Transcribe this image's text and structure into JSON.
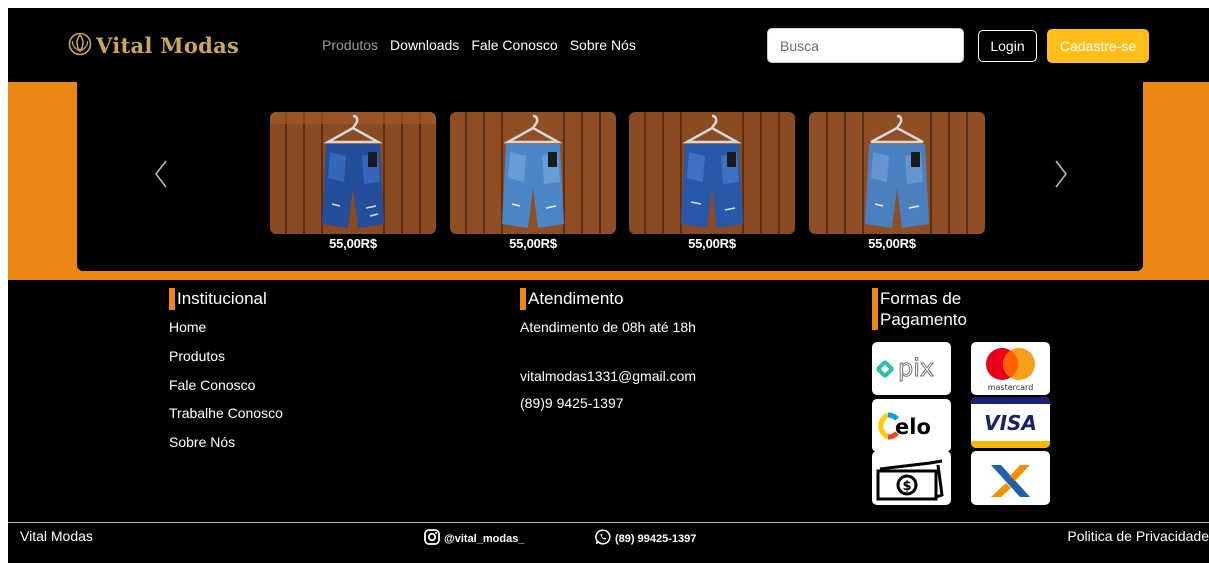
{
  "header": {
    "brand": "Vital Modas",
    "nav": [
      "Produtos",
      "Downloads",
      "Fale Conosco",
      "Sobre Nós"
    ],
    "active_nav": "Produtos",
    "search_placeholder": "Busca",
    "login_label": "Login",
    "signup_label": "Cadastre-se"
  },
  "carousel": {
    "products": [
      {
        "image": "jeans-shorts-dark",
        "price": "55,00R$"
      },
      {
        "image": "jeans-shorts-light",
        "price": "55,00R$"
      },
      {
        "image": "jeans-shorts-dark",
        "price": "55,00R$"
      },
      {
        "image": "jeans-shorts-light",
        "price": "55,00R$"
      }
    ],
    "prev_icon": "chevron-left-icon",
    "next_icon": "chevron-right-icon"
  },
  "institucional": {
    "title": "Institucional",
    "links": [
      "Home",
      "Produtos",
      "Fale Conosco",
      "Trabalhe Conosco",
      "Sobre Nós"
    ]
  },
  "atendimento": {
    "title": "Atendimento",
    "hours": "Atendimento de 08h até 18h",
    "email": "vitalmodas1331@gmail.com",
    "phone": "(89)9 9425-1397"
  },
  "pagamento": {
    "title_line1": "Formas de",
    "title_line2": "Pagamento",
    "methods": [
      "pix",
      "mastercard",
      "elo",
      "visa",
      "cash",
      "caixa"
    ],
    "pix_label": "pix",
    "mastercard_label": "mastercard",
    "elo_label": "elo",
    "visa_label": "VISA"
  },
  "footer": {
    "brand": "Vital Modas",
    "instagram": "@vital_modas_",
    "whatsapp": "(89) 99425-1397",
    "privacy": "Politica de Privacidade"
  },
  "colors": {
    "orange": "#ec8615",
    "yellow_button": "#ffbf18",
    "gold_logo": "#c9a85a",
    "background": "#000000"
  }
}
